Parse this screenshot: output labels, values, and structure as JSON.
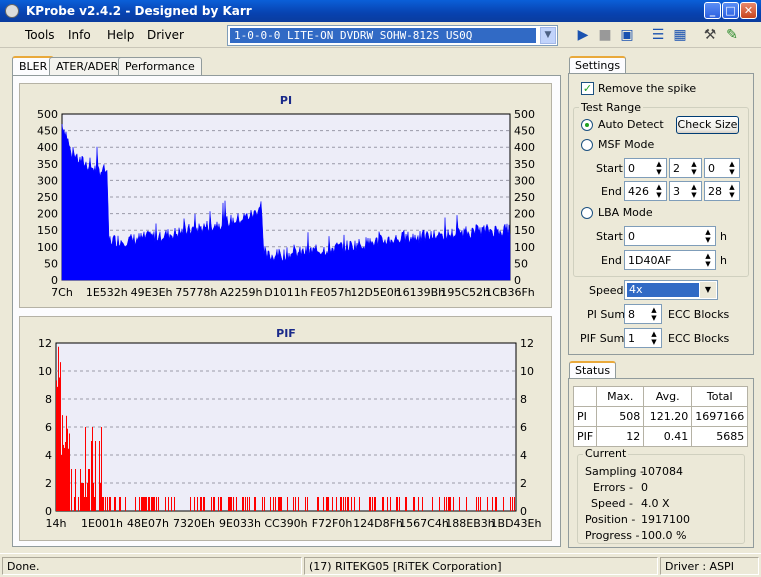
{
  "window": {
    "title": "KProbe v2.4.2 - Designed by Karr",
    "min": "_",
    "max": "□",
    "close": "✕"
  },
  "menu": [
    "Tools",
    "Info",
    "Help",
    "Driver"
  ],
  "drive": {
    "value": "1-0-0-0 LITE-ON DVDRW SOHW-812S  US0Q"
  },
  "toolbar_icons": [
    "play-icon",
    "stop-icon",
    "save-icon",
    "layout-icon",
    "table-icon",
    "tools-icon",
    "screenshot-icon"
  ],
  "tabs": [
    "BLER",
    "ATER/ADER",
    "Performance"
  ],
  "active_tab": "BLER",
  "settings": {
    "tab_label": "Settings",
    "remove_spike": {
      "label": "Remove the spike",
      "checked": true
    },
    "test_range_label": "Test Range",
    "auto_detect": {
      "label": "Auto Detect",
      "checked": true
    },
    "check_size_btn": "Check Size",
    "msf_mode": {
      "label": "MSF Mode",
      "checked": false,
      "start_label": "Start",
      "end_label": "End",
      "start": [
        "0",
        "2",
        "0"
      ],
      "end": [
        "426",
        "3",
        "28"
      ]
    },
    "lba_mode": {
      "label": "LBA Mode",
      "checked": false,
      "start_label": "Start",
      "end_label": "End",
      "start": "0",
      "end": "1D40AF",
      "unit": "h"
    },
    "speed": {
      "label": "Speed",
      "value": "4x"
    },
    "pi_sum": {
      "label": "PI Sum",
      "value": "8",
      "unit": "ECC Blocks"
    },
    "pif_sum": {
      "label": "PIF Sum",
      "value": "1",
      "unit": "ECC Blocks"
    }
  },
  "status": {
    "tab_label": "Status",
    "headers": [
      "",
      "Max.",
      "Avg.",
      "Total"
    ],
    "rows": [
      [
        "PI",
        "508",
        "121.20",
        "1697166"
      ],
      [
        "PIF",
        "12",
        "0.41",
        "5685"
      ]
    ],
    "current": {
      "label": "Current",
      "items": [
        {
          "label": "Sampling -",
          "value": "107084"
        },
        {
          "label": "Errors -",
          "value": "0"
        },
        {
          "label": "Speed -",
          "value": "4.0  X"
        },
        {
          "label": "Position -",
          "value": "1917100"
        },
        {
          "label": "Progress -",
          "value": "100.0 %"
        }
      ]
    }
  },
  "statusbar": {
    "left": "Done.",
    "middle": "(17) RITEKG05 [RiTEK Corporation]",
    "right": "Driver : ASPI"
  },
  "chart_data": [
    {
      "type": "area",
      "title": "PI",
      "ylim": [
        0,
        500
      ],
      "yticks": [
        0,
        50,
        100,
        150,
        200,
        250,
        300,
        350,
        400,
        450,
        500
      ],
      "xtick_labels": [
        "7Ch",
        "1E532h",
        "49E3Eh",
        "75778h",
        "A2259h",
        "D1011h",
        "FE057h",
        "12D5E0h",
        "16139Bh",
        "195C52h",
        "1CB36Fh"
      ],
      "color": "#0000ff",
      "grid": true,
      "profile_x": [
        0,
        0.01,
        0.02,
        0.04,
        0.06,
        0.08,
        0.1,
        0.105,
        0.11,
        0.15,
        0.2,
        0.25,
        0.3,
        0.35,
        0.4,
        0.43,
        0.44,
        0.445,
        0.45,
        0.48,
        0.55,
        0.6,
        0.65,
        0.7,
        0.75,
        0.8,
        0.85,
        0.9,
        0.95,
        1.0
      ],
      "profile_y": [
        470,
        440,
        380,
        360,
        345,
        330,
        330,
        120,
        120,
        120,
        130,
        140,
        155,
        170,
        185,
        200,
        220,
        240,
        70,
        75,
        85,
        95,
        105,
        115,
        125,
        130,
        135,
        145,
        150,
        150
      ]
    },
    {
      "type": "bar",
      "title": "PIF",
      "ylim": [
        0,
        12
      ],
      "yticks": [
        0,
        2,
        4,
        6,
        8,
        10,
        12
      ],
      "xtick_labels": [
        "14h",
        "1E001h",
        "48E07h",
        "7320Eh",
        "9E033h",
        "CC390h",
        "F72F0h",
        "124D8Fh",
        "1567C4h",
        "188EB3h",
        "1BD43Eh"
      ],
      "color": "#ff0000",
      "grid": true
    }
  ]
}
